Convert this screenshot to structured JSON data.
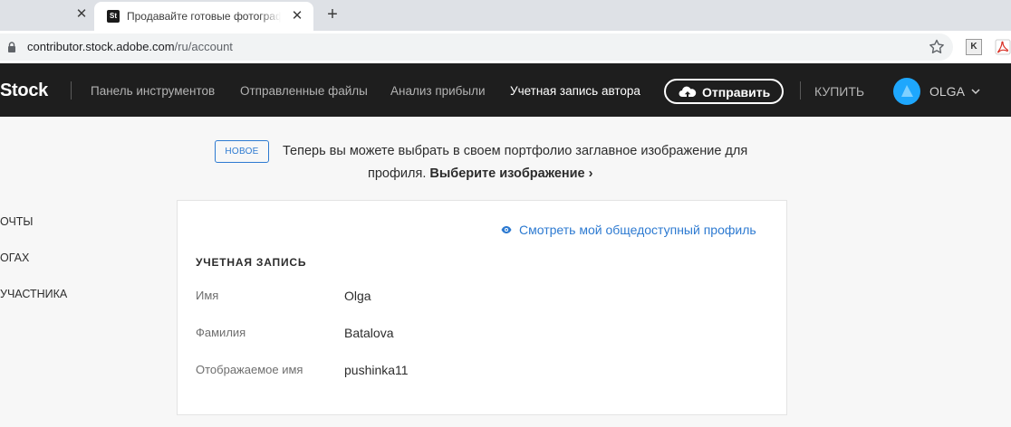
{
  "browser": {
    "active_tab_title": "Продавайте готовые фотографии",
    "url_host": "contributor.stock.adobe.com",
    "url_path": "/ru/account",
    "tab_icon_text": "St",
    "ext1_text": "K"
  },
  "nav": {
    "brand": "Stock",
    "links": [
      "Панель инструментов",
      "Отправленные файлы",
      "Анализ прибыли",
      "Учетная запись автора"
    ],
    "submit_label": "Отправить",
    "buy_label": "КУПИТЬ",
    "user_name": "OLGA"
  },
  "announcement": {
    "badge": "НОВОЕ",
    "line1": "Теперь вы можете выбрать в своем портфолио заглавное изображение для",
    "line2_prefix": "профиля.",
    "link": "Выберите изображение ›"
  },
  "sidebar": {
    "items": [
      "ОЧТЫ",
      "ОГАХ",
      "УЧАСТНИКА"
    ]
  },
  "account": {
    "public_profile_link": "Смотреть мой общедоступный профиль",
    "section_title": "УЧЕТНАЯ ЗАПИСЬ",
    "fields": [
      {
        "label": "Имя",
        "value": "Olga"
      },
      {
        "label": "Фамилия",
        "value": "Batalova"
      },
      {
        "label": "Отображаемое имя",
        "value": "pushinka11"
      }
    ]
  },
  "colors": {
    "nav_bg": "#1e1e1e",
    "accent_blue": "#2d7ad1",
    "avatar_blue": "#1ea7fd"
  }
}
